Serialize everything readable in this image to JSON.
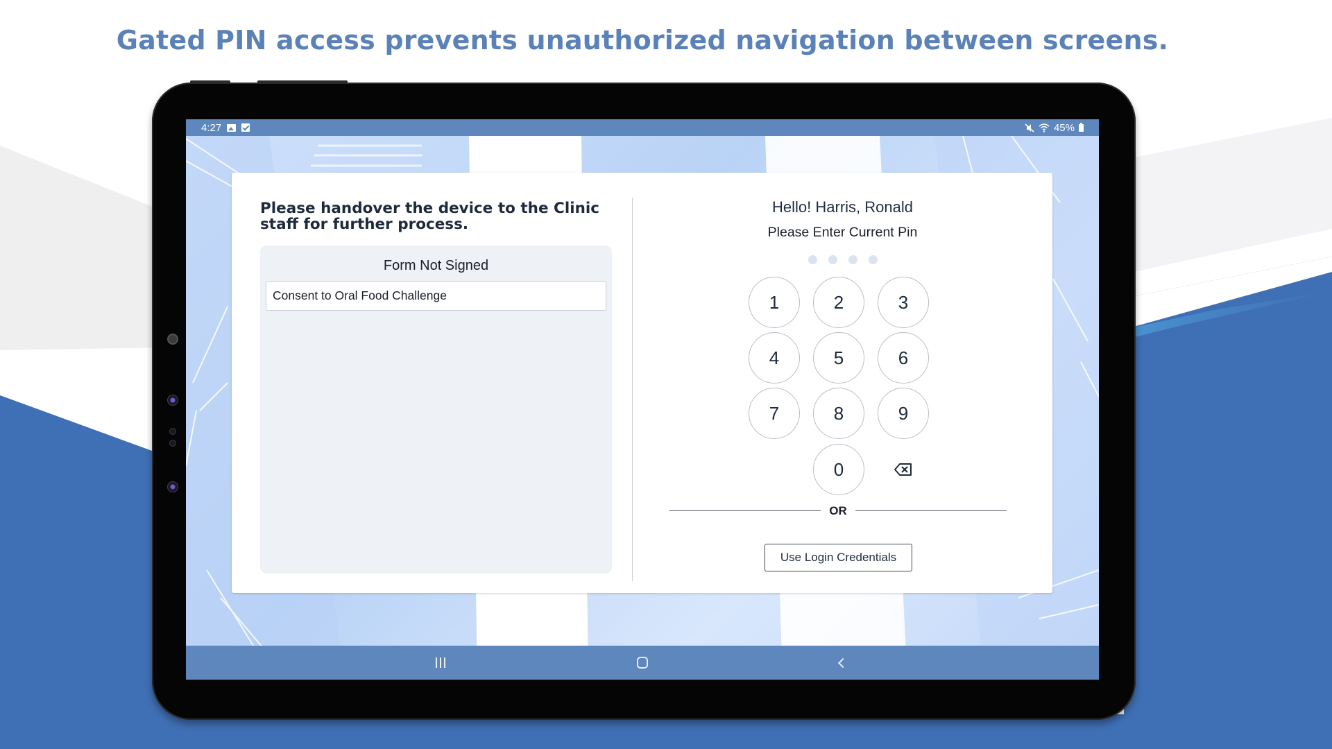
{
  "headline": "Gated PIN access prevents unauthorized navigation between screens.",
  "colors": {
    "headline": "#5b82b8",
    "system_bar": "#5e87bd",
    "background_blue": "#3f6fb4",
    "panel_gray": "#eef2f6"
  },
  "status_bar": {
    "time": "4:27",
    "left_icons": [
      "image-icon",
      "checkbox-icon"
    ],
    "right_icons": [
      "mute-icon",
      "wifi-icon",
      "battery-icon"
    ],
    "battery_percent": "45%"
  },
  "left_pane": {
    "instruction": "Please handover the device to the Clinic staff for further process.",
    "forms_panel": {
      "title": "Form Not Signed",
      "items": [
        {
          "label": "Consent to Oral Food Challenge"
        }
      ]
    }
  },
  "right_pane": {
    "greeting": "Hello! Harris, Ronald",
    "prompt": "Please Enter Current Pin",
    "pin_length": 4,
    "pin_entered": 0,
    "keys": [
      "1",
      "2",
      "3",
      "4",
      "5",
      "6",
      "7",
      "8",
      "9",
      "0"
    ],
    "backspace_icon": "backspace-icon",
    "or_label": "OR",
    "login_button": "Use Login Credentials"
  },
  "nav_bar": {
    "buttons": [
      "recents",
      "home",
      "back"
    ]
  }
}
